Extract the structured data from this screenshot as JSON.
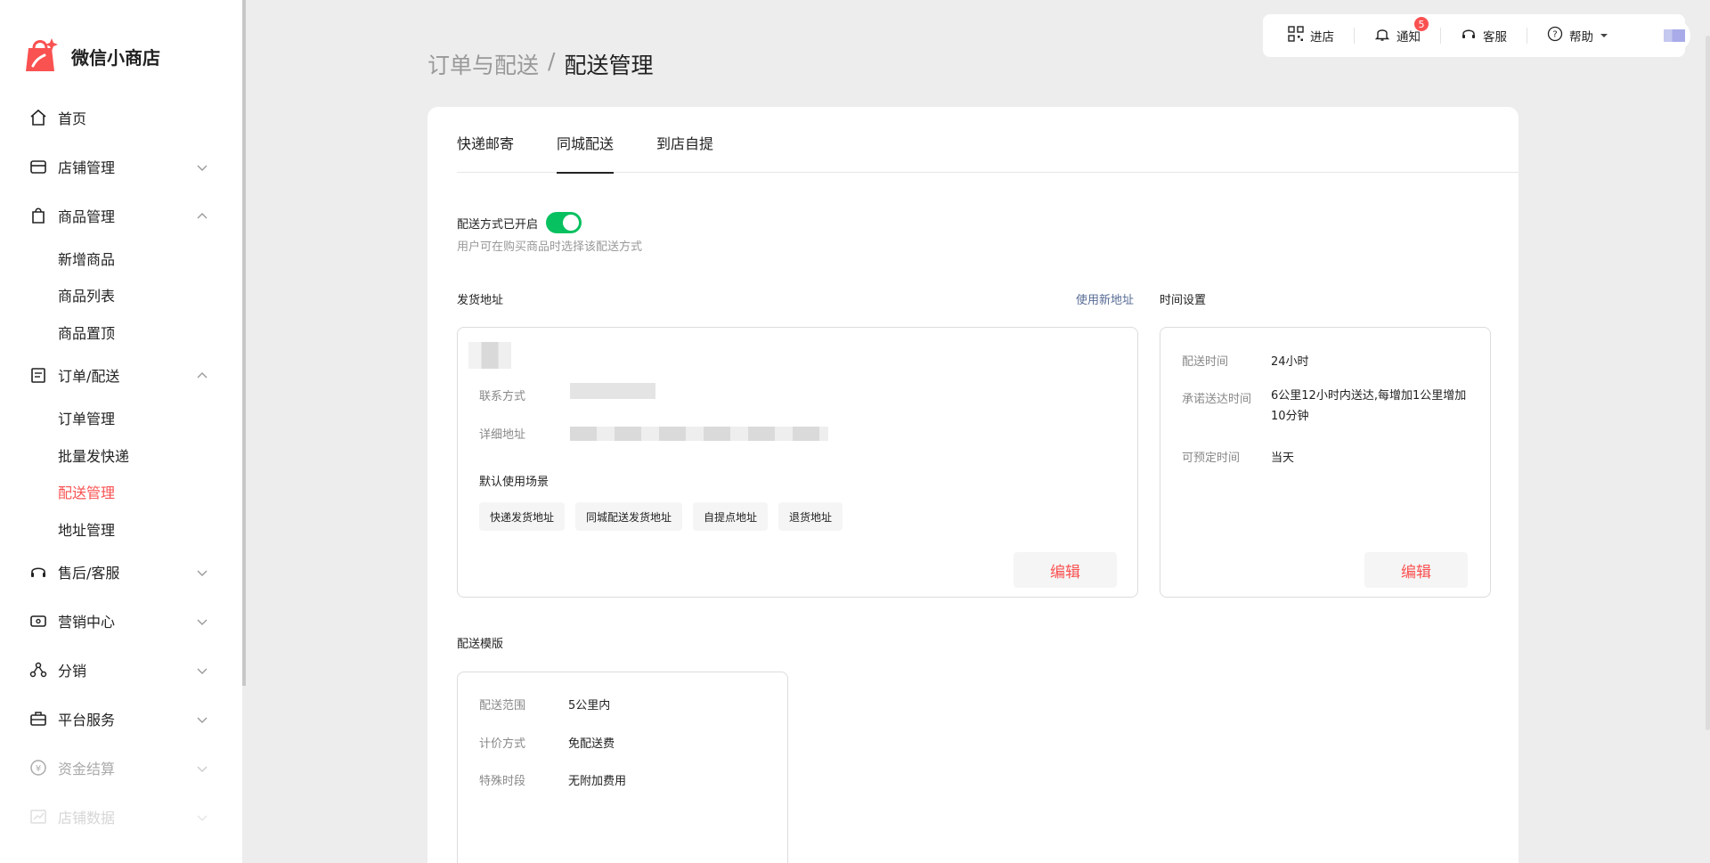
{
  "app": {
    "name": "微信小商店"
  },
  "sidebar": {
    "items": [
      {
        "label": "首页",
        "icon": "home-icon"
      },
      {
        "label": "店铺管理",
        "icon": "store-icon"
      },
      {
        "label": "商品管理",
        "icon": "bag-icon",
        "expanded": true,
        "children": [
          "新增商品",
          "商品列表",
          "商品置顶"
        ]
      },
      {
        "label": "订单/配送",
        "icon": "clipboard-icon",
        "expanded": true,
        "children": [
          "订单管理",
          "批量发快递",
          "配送管理",
          "地址管理"
        ],
        "active_child": "配送管理"
      },
      {
        "label": "售后/客服",
        "icon": "headset-icon"
      },
      {
        "label": "营销中心",
        "icon": "ticket-icon"
      },
      {
        "label": "分销",
        "icon": "share-icon"
      },
      {
        "label": "平台服务",
        "icon": "briefcase-icon"
      },
      {
        "label": "资金结算",
        "icon": "yuan-icon"
      },
      {
        "label": "店铺数据",
        "icon": "chart-icon"
      }
    ]
  },
  "topbar": {
    "enter_store": "进店",
    "notify": "通知",
    "notify_count": "5",
    "service": "客服",
    "help": "帮助"
  },
  "breadcrumb": {
    "parent": "订单与配送",
    "separator": "/",
    "current": "配送管理"
  },
  "tabs": [
    "快递邮寄",
    "同城配送",
    "到店自提"
  ],
  "active_tab": "同城配送",
  "delivery_toggle": {
    "label": "配送方式已开启",
    "enabled": true,
    "description": "用户可在购买商品时选择该配送方式"
  },
  "address": {
    "title": "发货地址",
    "new_link": "使用新地址",
    "contact_label": "联系方式",
    "detail_label": "详细地址",
    "scene_title": "默认使用场景",
    "tags": [
      "快递发货地址",
      "同城配送发货地址",
      "自提点地址",
      "退货地址"
    ],
    "edit": "编辑"
  },
  "time_settings": {
    "title": "时间设置",
    "rows": [
      {
        "label": "配送时间",
        "value": "24小时"
      },
      {
        "label": "承诺送达时间",
        "value": "6公里12小时内送达,每增加1公里增加10分钟"
      },
      {
        "label": "可预定时间",
        "value": "当天"
      }
    ],
    "edit": "编辑"
  },
  "template": {
    "title": "配送模版",
    "rows": [
      {
        "label": "配送范围",
        "value": "5公里内"
      },
      {
        "label": "计价方式",
        "value": "免配送费"
      },
      {
        "label": "特殊时段",
        "value": "无附加费用"
      }
    ]
  },
  "colors": {
    "accent": "#fa5151",
    "toggle_on": "#07c160",
    "link": "#576b95"
  }
}
